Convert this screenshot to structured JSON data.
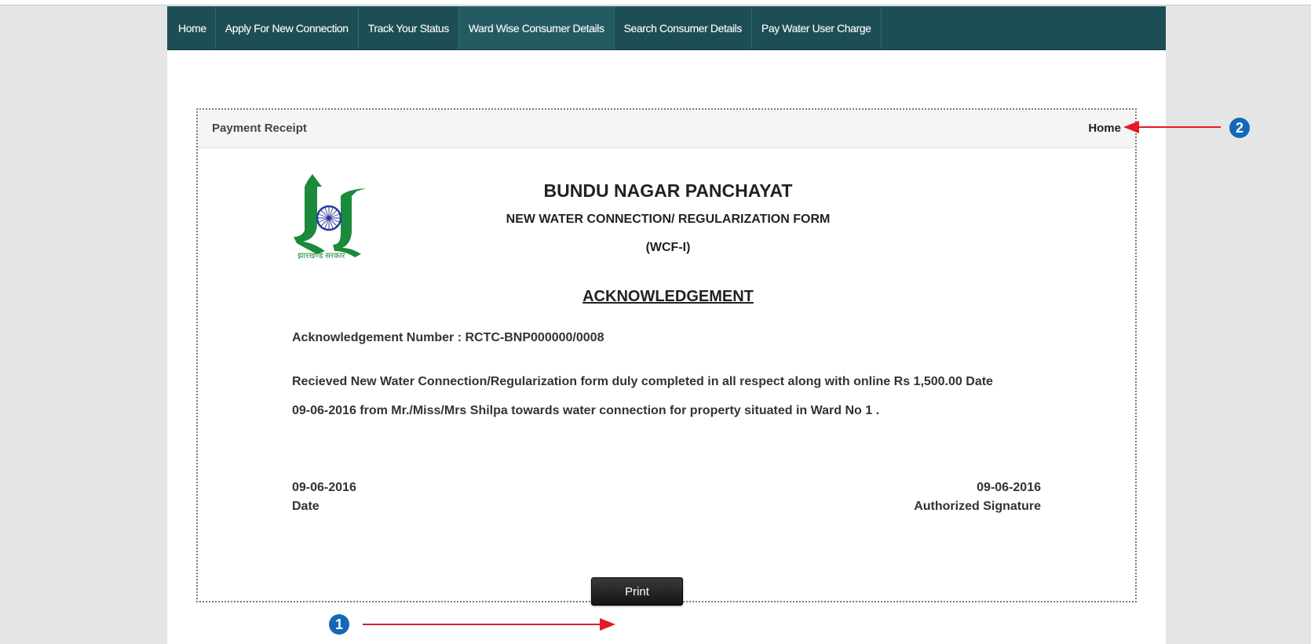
{
  "nav": {
    "items": [
      {
        "label": "Home"
      },
      {
        "label": "Apply For New Connection"
      },
      {
        "label": "Track Your Status"
      },
      {
        "label": "Ward Wise Consumer Details"
      },
      {
        "label": "Search Consumer Details"
      },
      {
        "label": "Pay Water User Charge"
      }
    ]
  },
  "receipt": {
    "title": "Payment Receipt",
    "home_link": "Home",
    "logo_caption": "झारखण्ड सरकार",
    "org_name": "BUNDU NAGAR PANCHAYAT",
    "form_name": "NEW WATER CONNECTION/ REGULARIZATION FORM",
    "form_code": "(WCF-I)",
    "ack_title": "ACKNOWLEDGEMENT",
    "ack_label": "Acknowledgement Number : ",
    "ack_number": "RCTC-BNP000000/0008",
    "body_text": "Recieved New Water Connection/Regularization form duly completed in all respect along with online Rs 1,500.00 Date 09-06-2016 from Mr./Miss/Mrs Shilpa towards water connection for property situated in Ward No 1 .",
    "left_date": "09-06-2016",
    "left_date_label": "Date",
    "right_date": "09-06-2016",
    "right_date_label": "Authorized Signature"
  },
  "actions": {
    "print_label": "Print"
  },
  "callouts": {
    "one": "1",
    "two": "2"
  },
  "colors": {
    "navbar": "#1d4e56",
    "callout": "#1468b8",
    "arrow": "#e21b23",
    "logo_green": "#1b8a3a",
    "chakra": "#2b3a9a"
  }
}
